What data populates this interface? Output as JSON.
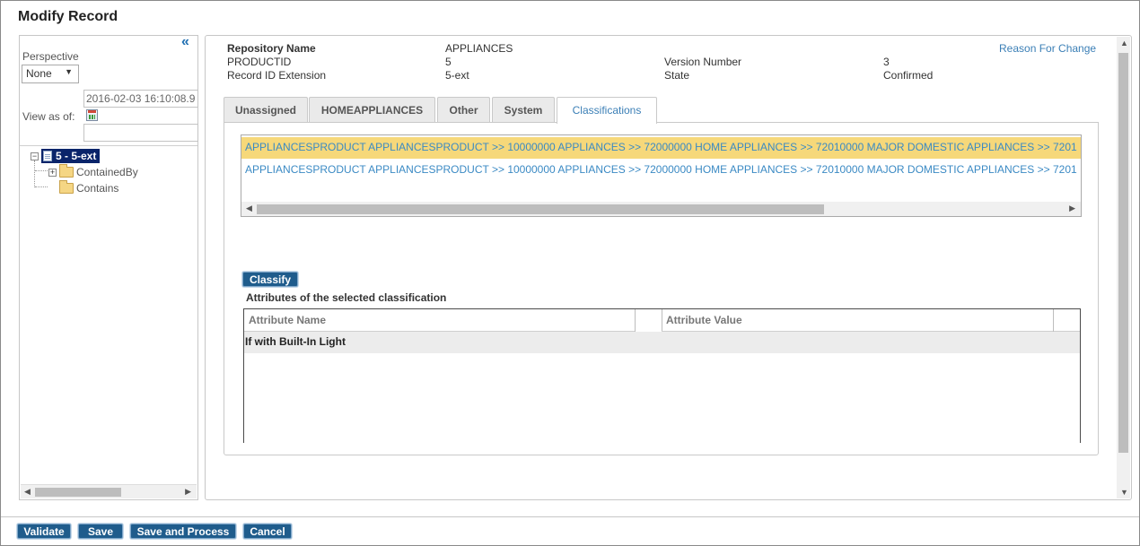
{
  "title": "Modify Record",
  "left": {
    "perspective_label": "Perspective",
    "perspective_value": "None",
    "view_as_of_label": "View as of:",
    "view_as_of_date": "2016-02-03 16:10:08.9",
    "view_as_of_time": "",
    "tree": {
      "root": "5 - 5-ext",
      "children": [
        "ContainedBy",
        "Contains"
      ]
    }
  },
  "header": {
    "repository_name_label": "Repository Name",
    "repository_name_value": "APPLIANCES",
    "productid_label": "PRODUCTID",
    "productid_value": "5",
    "record_id_ext_label": "Record ID Extension",
    "record_id_ext_value": "5-ext",
    "version_label": "Version Number",
    "version_value": "3",
    "state_label": "State",
    "state_value": "Confirmed",
    "reason_link": "Reason For Change"
  },
  "tabs": [
    "Unassigned",
    "HOMEAPPLIANCES",
    "Other",
    "System",
    "Classifications"
  ],
  "active_tab": "Classifications",
  "classifications": [
    "APPLIANCESPRODUCT APPLIANCESPRODUCT >> 10000000 APPLIANCES >> 72000000 HOME APPLIANCES >> 72010000 MAJOR DOMESTIC APPLIANCES >> 7201",
    "APPLIANCESPRODUCT APPLIANCESPRODUCT >> 10000000 APPLIANCES >> 72000000 HOME APPLIANCES >> 72010000 MAJOR DOMESTIC APPLIANCES >> 7201"
  ],
  "classify_button": "Classify",
  "attributes_title": "Attributes of the selected classification",
  "attr_table": {
    "col_name": "Attribute Name",
    "col_value": "Attribute Value",
    "rows": [
      {
        "name": "If with Built-In Light",
        "value": ""
      }
    ]
  },
  "buttons": {
    "validate": "Validate",
    "save": "Save",
    "save_process": "Save and Process",
    "cancel": "Cancel"
  },
  "colors": {
    "button_bg": "#1f5c8c",
    "selected_row": "#f6d87a",
    "link": "#3b7fb6",
    "tree_selected": "#0a246a"
  }
}
